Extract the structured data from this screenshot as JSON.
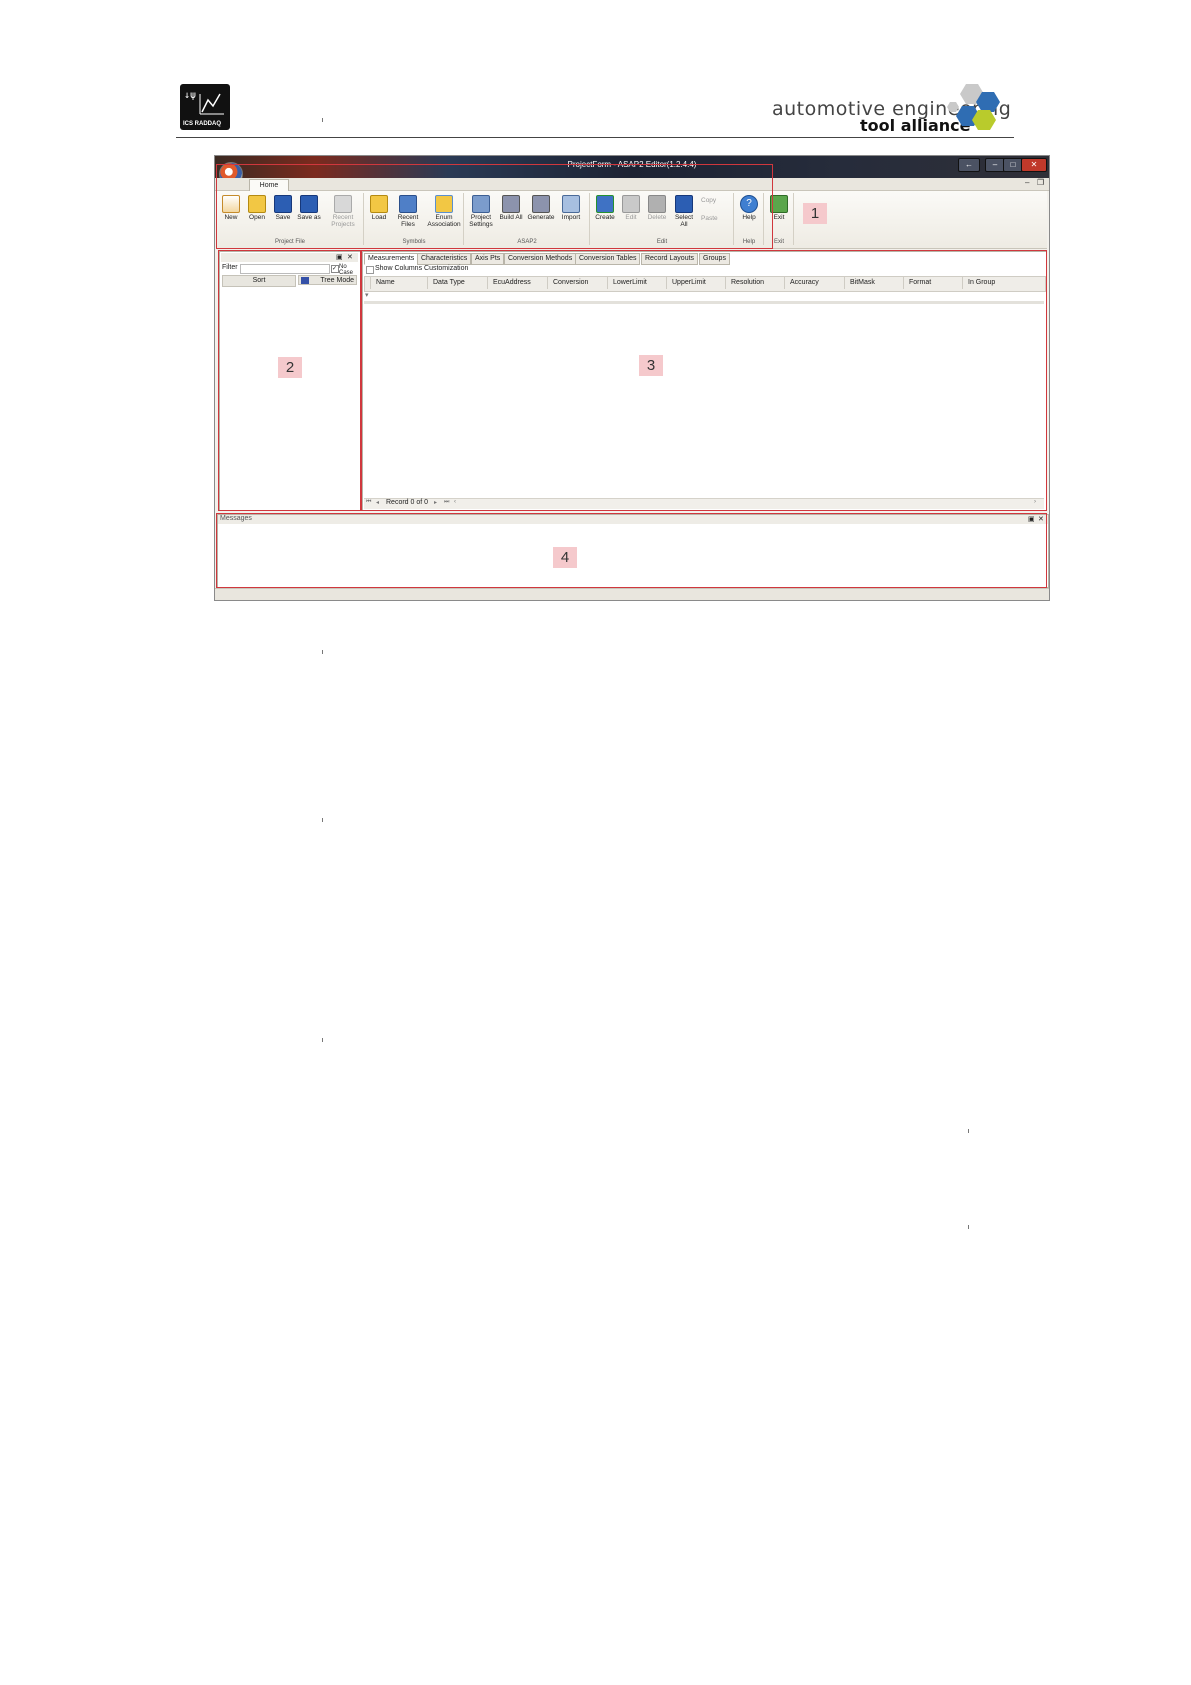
{
  "page_header": {
    "logo_caption": "ICS RADDAQ",
    "logo_symbol": "↓ψ",
    "brand_line1": "automotive engineering",
    "brand_line2": "tool alliance"
  },
  "app": {
    "window_title": "ProjectForm - ASAP2 Editor(1.2.4.4)",
    "menu_tab": "Home",
    "ribbon_groups": [
      {
        "label": "Project File",
        "buttons": [
          "New",
          "Open",
          "Save",
          "Save as",
          "Recent Projects"
        ]
      },
      {
        "label": "Symbols",
        "buttons": [
          "Load",
          "Recent Files",
          "Enum Association"
        ]
      },
      {
        "label": "ASAP2",
        "buttons": [
          "Project Settings",
          "Build All",
          "Generate",
          "Import"
        ]
      },
      {
        "label": "Edit",
        "buttons": [
          "Create",
          "Edit",
          "Delete",
          "Select All",
          "Copy",
          "Paste"
        ]
      },
      {
        "label": "Help",
        "buttons": [
          "Help"
        ]
      },
      {
        "label": "Exit",
        "buttons": [
          "Exit"
        ]
      }
    ],
    "left_panel": {
      "filter_label": "Filter",
      "no_case": "No Case",
      "sort_button": "Sort",
      "tree_mode_button": "Tree Mode"
    },
    "tabs": [
      "Measurements",
      "Characteristics",
      "Axis Pts",
      "Conversion Methods",
      "Conversion Tables",
      "Record Layouts",
      "Groups"
    ],
    "show_columns_label": "Show Columns Customization",
    "columns": [
      "Name",
      "Data Type",
      "EcuAddress",
      "Conversion",
      "LowerLimit",
      "UpperLimit",
      "Resolution",
      "Accuracy",
      "BitMask",
      "Format",
      "In Group"
    ],
    "pager_text": "Record 0 of 0",
    "messages_title": "Messages"
  },
  "region_labels": [
    "1",
    "2",
    "3",
    "4"
  ],
  "colors": {
    "highlight_box": "#d0373d",
    "tag_fill": "#f5c9cc"
  }
}
